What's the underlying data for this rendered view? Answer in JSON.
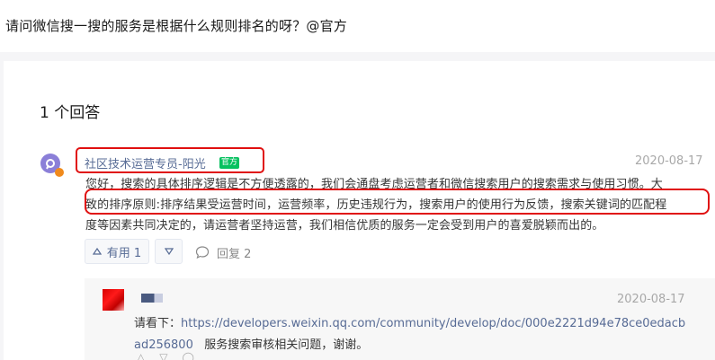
{
  "page": {
    "title": "请问微信搜一搜的服务是根据什么规则排名的呀？@官方"
  },
  "answers_header": {
    "count_label": "1 个回答"
  },
  "answer": {
    "author": "社区技术运营专员-阳光",
    "badge": "官方",
    "date": "2020-08-17",
    "lines": [
      "您好，搜索的具体排序逻辑是不方便透露的，我们会通盘考虑运营者和微信搜索用户的搜索需求与使用习惯。大",
      "致的排序原则:排序结果受运营时间，运营频率，历史违规行为，搜索用户的使用行为反馈，搜索关键词的匹配程",
      "度等因素共同决定的，请运营者坚持运营，我们相信优质的服务一定会受到用户的喜爱脱颖而出的。"
    ],
    "upvote_label": "有用 1",
    "reply_label": "回复 2"
  },
  "comment": {
    "date": "2020-08-17",
    "prefix": "请看下：",
    "link_line1": "https://developers.weixin.qq.com/community/develop/doc/000e2221d94e78ce0edacb",
    "link_line2": "ad256800",
    "suffix": "服务搜索审核相关问题，谢谢。"
  },
  "colors": {
    "highlight_red": "#e01010",
    "link_blue": "#576b95",
    "badge_green": "#07c160"
  }
}
